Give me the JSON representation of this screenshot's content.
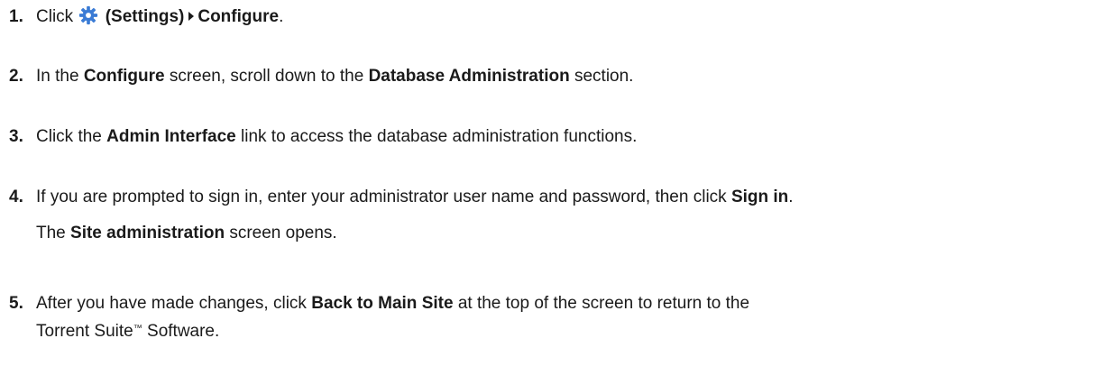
{
  "steps": [
    {
      "number": "1.",
      "click": "Click",
      "settings_label": "(Settings)",
      "configure": "Configure",
      "end": "."
    },
    {
      "number": "2.",
      "pre": "In the",
      "configure": "Configure",
      "mid": "screen, scroll down to the",
      "section": "Database Administration",
      "end": "section."
    },
    {
      "number": "3.",
      "pre": "Click the",
      "link": "Admin Interface",
      "end": "link to access the database administration functions."
    },
    {
      "number": "4.",
      "pre": "If you are prompted to sign in, enter your administrator user name and password, then click",
      "sign_in": "Sign in",
      "end": ".",
      "result_pre": "The",
      "result_bold": "Site administration",
      "result_end": "screen opens."
    },
    {
      "number": "5.",
      "pre": "After you have made changes, click",
      "back": "Back to Main Site",
      "end": "at the top of the screen to return to the",
      "line2_pre": "Torrent Suite",
      "trademark": "™",
      "line2_end": "Software."
    }
  ],
  "icon": {
    "settings": "gear-icon",
    "color": "#3a7bd5"
  }
}
